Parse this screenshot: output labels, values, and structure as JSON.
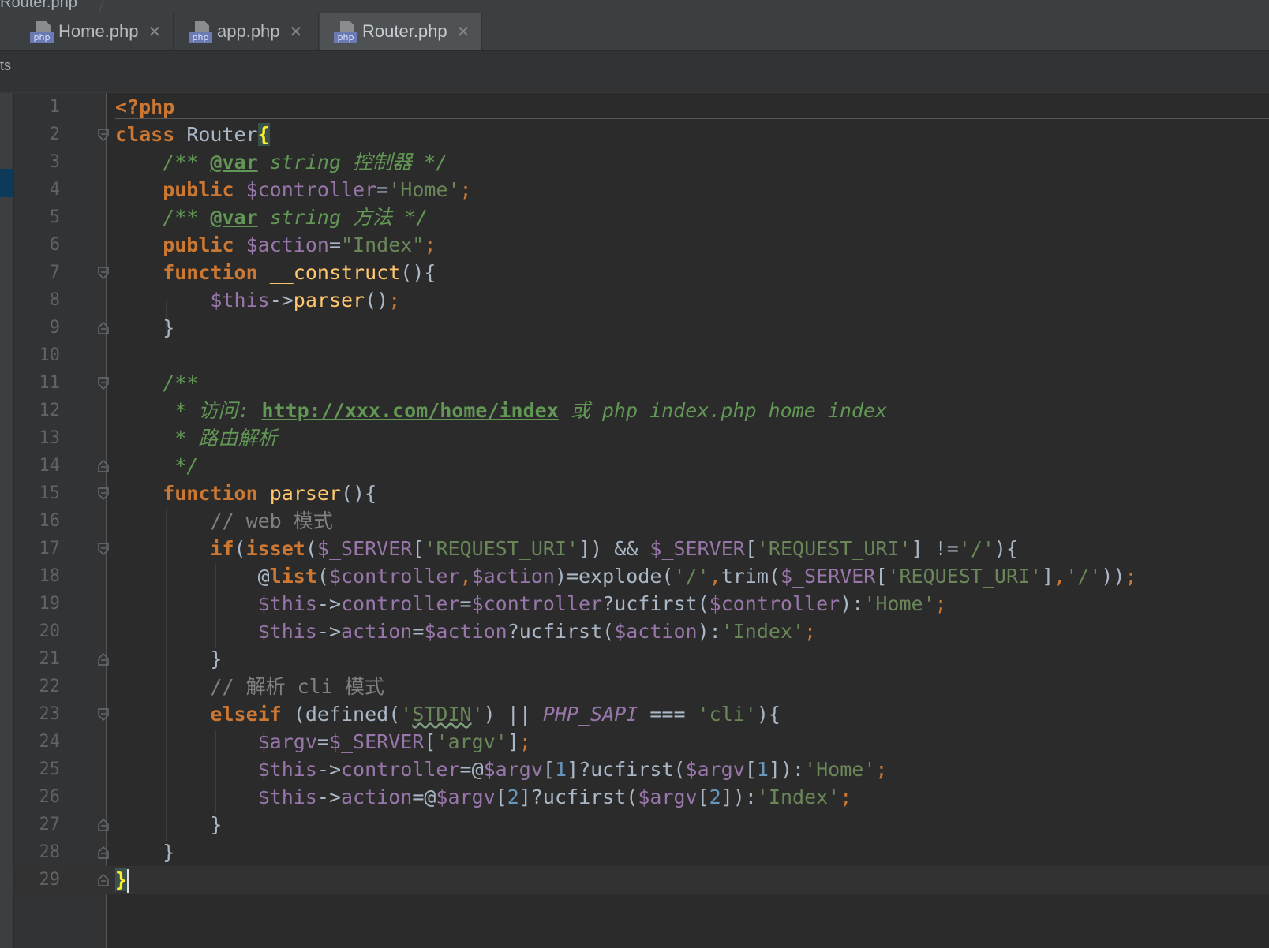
{
  "window": {
    "title": "Router.php"
  },
  "tabs": [
    {
      "label": "Home.php",
      "badge": "php",
      "active": false
    },
    {
      "label": "app.php",
      "badge": "php",
      "active": false
    },
    {
      "label": "Router.php",
      "badge": "php",
      "active": true
    }
  ],
  "sidebar": {
    "edge_label": "ts"
  },
  "editor": {
    "line_numbers": [
      "1",
      "2",
      "3",
      "4",
      "5",
      "6",
      "7",
      "8",
      "9",
      "10",
      "11",
      "12",
      "13",
      "14",
      "15",
      "16",
      "17",
      "18",
      "19",
      "20",
      "21",
      "22",
      "23",
      "24",
      "25",
      "26",
      "27",
      "28",
      "29"
    ],
    "current_line": 29,
    "tokens": {
      "l1_open": "<?php",
      "l2_class": "class",
      "l2_name": " Router",
      "l2_brace": "{",
      "l3": "    /** ",
      "l3_tag": "@var",
      "l3_rest": " string 控制器 */",
      "l4_pub": "    public",
      "l4_sp": " ",
      "l4_var": "$controller",
      "l4_eq": "=",
      "l4_str": "'Home'",
      "l4_semi": ";",
      "l5": "    /** ",
      "l5_tag": "@var",
      "l5_rest": " string 方法 */",
      "l6_pub": "    public",
      "l6_sp": " ",
      "l6_var": "$action",
      "l6_eq": "=",
      "l6_str": "\"Index\"",
      "l6_semi": ";",
      "l7_fn": "    function",
      "l7_sp": " ",
      "l7_name": "__construct",
      "l7_rest": "(){",
      "l8_ind": "        ",
      "l8_this": "$this",
      "l8_arrow": "->",
      "l8_call": "parser",
      "l8_paren": "()",
      "l8_semi": ";",
      "l9": "    }",
      "l11": "    /**",
      "l12_a": "     * 访问: ",
      "l12_link": "http://xxx.com/home/index",
      "l12_b": " 或 php index.php home index",
      "l13": "     * 路由解析",
      "l14": "     */",
      "l15_fn": "    function",
      "l15_sp": " ",
      "l15_name": "parser",
      "l15_rest": "(){",
      "l16": "        // web 模式",
      "l17_ind": "        ",
      "l17_if": "if",
      "l17_p1": "(",
      "l17_isset": "isset",
      "l17_p2": "(",
      "l17_v1": "$_SERVER",
      "l17_b1": "[",
      "l17_s1": "'REQUEST_URI'",
      "l17_b2": "]) && ",
      "l17_v2": "$_SERVER",
      "l17_b3": "[",
      "l17_s2": "'REQUEST_URI'",
      "l17_b4": "] !=",
      "l17_s3": "'/'",
      "l17_end": "){",
      "l18_ind": "            @",
      "l18_list": "list",
      "l18_p": "(",
      "l18_v1": "$controller",
      "l18_c1": ",",
      "l18_v2": "$action",
      "l18_mid": ")=explode(",
      "l18_s1": "'/'",
      "l18_c2": ",",
      "l18_trim": "trim(",
      "l18_v3": "$_SERVER",
      "l18_b1": "[",
      "l18_s2": "'REQUEST_URI'",
      "l18_b2": "]",
      "l18_c3": ",",
      "l18_s3": "'/'",
      "l18_end": "))",
      "l18_semi": ";",
      "l19_ind": "            ",
      "l19_this": "$this",
      "l19_arrow": "->",
      "l19_prop": "controller",
      "l19_eq": "=",
      "l19_v1": "$controller",
      "l19_q": "?ucfirst(",
      "l19_v2": "$controller",
      "l19_c": "):",
      "l19_s": "'Home'",
      "l19_semi": ";",
      "l20_ind": "            ",
      "l20_this": "$this",
      "l20_arrow": "->",
      "l20_prop": "action",
      "l20_eq": "=",
      "l20_v1": "$action",
      "l20_q": "?ucfirst(",
      "l20_v2": "$action",
      "l20_c": "):",
      "l20_s": "'Index'",
      "l20_semi": ";",
      "l21": "        }",
      "l22": "        // 解析 cli 模式",
      "l23_ind": "        ",
      "l23_kw": "elseif",
      "l23_a": " (defined(",
      "l23_s1a": "'",
      "l23_s1": "STDIN",
      "l23_s1b": "'",
      "l23_b": ") || ",
      "l23_const": "PHP_SAPI",
      "l23_c": " === ",
      "l23_s2": "'cli'",
      "l23_end": "){",
      "l24_ind": "            ",
      "l24_v1": "$argv",
      "l24_eq": "=",
      "l24_v2": "$_SERVER",
      "l24_b1": "[",
      "l24_s": "'argv'",
      "l24_b2": "]",
      "l24_semi": ";",
      "l25_ind": "            ",
      "l25_this": "$this",
      "l25_arrow": "->",
      "l25_prop": "controller",
      "l25_eq": "=@",
      "l25_v1": "$argv",
      "l25_b1": "[",
      "l25_n1": "1",
      "l25_b2": "]?ucfirst(",
      "l25_v2": "$argv",
      "l25_b3": "[",
      "l25_n2": "1",
      "l25_b4": "]):",
      "l25_s": "'Home'",
      "l25_semi": ";",
      "l26_ind": "            ",
      "l26_this": "$this",
      "l26_arrow": "->",
      "l26_prop": "action",
      "l26_eq": "=@",
      "l26_v1": "$argv",
      "l26_b1": "[",
      "l26_n1": "2",
      "l26_b2": "]?ucfirst(",
      "l26_v2": "$argv",
      "l26_b3": "[",
      "l26_n2": "2",
      "l26_b4": "]):",
      "l26_s": "'Index'",
      "l26_semi": ";",
      "l27": "        }",
      "l28": "    }",
      "l29_brace": "}"
    }
  },
  "colors": {
    "background": "#2b2b2b",
    "keyword": "#cc7832",
    "function": "#ffc66d",
    "variable": "#9876aa",
    "string": "#6a8759",
    "number": "#6897bb",
    "doc_comment": "#629755",
    "line_comment": "#808080",
    "default_text": "#a9b7c6"
  },
  "icons": {
    "tab_file": "php-file-icon",
    "tab_close": "close-icon",
    "fold_marker": "fold-marker-icon"
  }
}
